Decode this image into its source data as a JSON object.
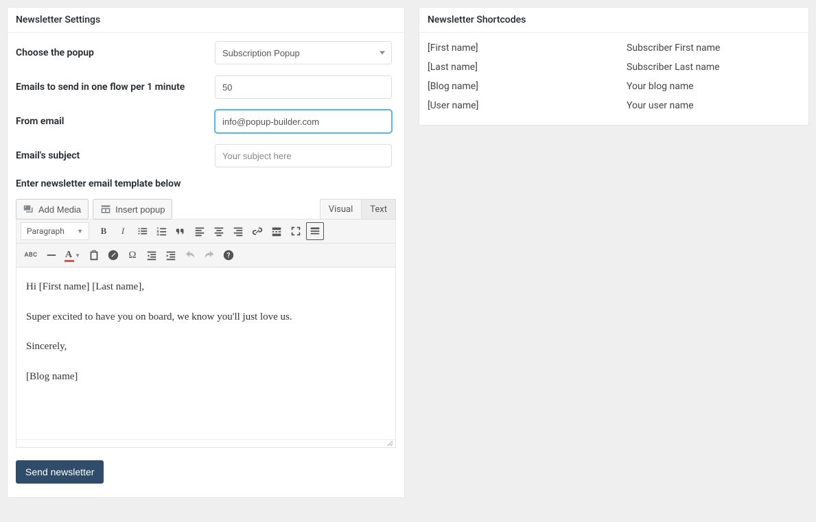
{
  "left_panel": {
    "title": "Newsletter Settings",
    "labels": {
      "choose_popup": "Choose the popup",
      "emails_flow": "Emails to send in one flow per 1 minute",
      "from_email": "From email",
      "subject": "Email's subject",
      "template": "Enter newsletter email template below"
    },
    "fields": {
      "popup_selected": "Subscription Popup",
      "emails_flow_value": "50",
      "from_email_value": "info@popup-builder.com",
      "subject_placeholder": "Your subject here"
    },
    "media": {
      "add_media": "Add Media",
      "insert_popup": "Insert popup"
    },
    "tabs": {
      "visual": "Visual",
      "text": "Text"
    },
    "format_select": "Paragraph",
    "body": {
      "p1": "Hi [First name] [Last name],",
      "p2": "Super excited to have you on board, we know you'll just love us.",
      "p3": "Sincerely,",
      "p4": "[Blog name]"
    },
    "send_button": "Send newsletter"
  },
  "right_panel": {
    "title": "Newsletter Shortcodes",
    "rows": [
      {
        "code": "[First name]",
        "desc": "Subscriber First name"
      },
      {
        "code": "[Last name]",
        "desc": "Subscriber Last name"
      },
      {
        "code": "[Blog name]",
        "desc": "Your blog name"
      },
      {
        "code": "[User name]",
        "desc": "Your user name"
      }
    ]
  }
}
